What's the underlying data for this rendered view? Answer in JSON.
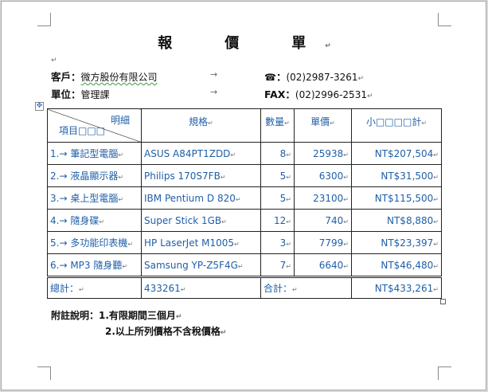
{
  "document": {
    "title": "報　價　單",
    "customer_label": "客戶：",
    "customer_value": "微方股份有限公司",
    "phone_icon": "telephone-icon",
    "phone_value": "(02)2987-3261",
    "unit_label": "單位：",
    "unit_value": "管理課",
    "fax_label": "FAX：",
    "fax_value": "(02)2996-2531"
  },
  "table": {
    "header": {
      "detail_top": "明細",
      "detail_bottom": "項目□□□",
      "spec": "規格",
      "qty": "數量",
      "unit_price": "單價",
      "subtotal": "小□□□□計"
    },
    "rows": [
      {
        "item": "1.→ 筆記型電腦",
        "spec": "ASUS A84PT1ZDD",
        "qty": "8",
        "price": "25938",
        "subtotal": "NT$207,504"
      },
      {
        "item": "2.→ 液晶顯示器",
        "spec": "Philips 170S7FB",
        "qty": "5",
        "price": "6300",
        "subtotal": "NT$31,500"
      },
      {
        "item": "3.→ 桌上型電腦",
        "spec": "IBM Pentium D 820",
        "qty": "5",
        "price": "23100",
        "subtotal": "NT$115,500"
      },
      {
        "item": "4.→ 隨身碟",
        "spec": "Super Stick 1GB",
        "qty": "12",
        "price": "740",
        "subtotal": "NT$8,880"
      },
      {
        "item": "5.→ 多功能印表機",
        "spec": "HP LaserJet M1005",
        "qty": "3",
        "price": "7799",
        "subtotal": "NT$23,397"
      },
      {
        "item": "6.→ MP3 隨身聽",
        "spec": "Samsung YP-Z5F4G",
        "qty": "7",
        "price": "6640",
        "subtotal": "NT$46,480"
      }
    ],
    "total": {
      "label": "總計：",
      "value": "433261",
      "sum_label": "合計：",
      "sum_value": "NT$433,261"
    }
  },
  "notes": {
    "line1": "附註說明：1.有限期間三個月",
    "line2": "2.以上所列價格不含稅價格"
  }
}
